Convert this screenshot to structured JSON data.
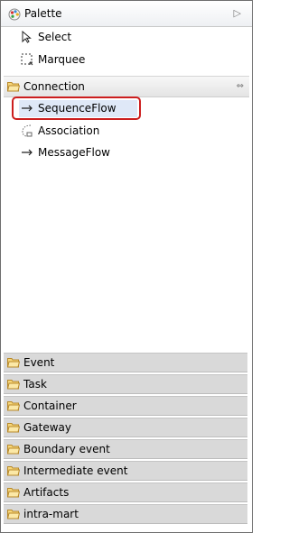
{
  "palette": {
    "title": "Palette",
    "collapse_icon": "triangle-right-icon"
  },
  "tools": [
    {
      "label": "Select",
      "icon": "arrow-pointer-icon"
    },
    {
      "label": "Marquee",
      "icon": "marquee-icon"
    }
  ],
  "connection": {
    "title": "Connection",
    "pin_icon": "pin-icon",
    "items": [
      {
        "label": "SequenceFlow",
        "icon": "arrow-right-icon",
        "selected": true
      },
      {
        "label": "Association",
        "icon": "association-icon"
      },
      {
        "label": "MessageFlow",
        "icon": "arrow-right-icon"
      }
    ]
  },
  "drawers": [
    {
      "label": "Event"
    },
    {
      "label": "Task"
    },
    {
      "label": "Container"
    },
    {
      "label": "Gateway"
    },
    {
      "label": "Boundary event"
    },
    {
      "label": "Intermediate event"
    },
    {
      "label": "Artifacts"
    },
    {
      "label": "intra-mart"
    }
  ],
  "colors": {
    "highlight": "#cc1e1e",
    "selection": "#dfe8f7",
    "folder": "#f0c24a"
  }
}
